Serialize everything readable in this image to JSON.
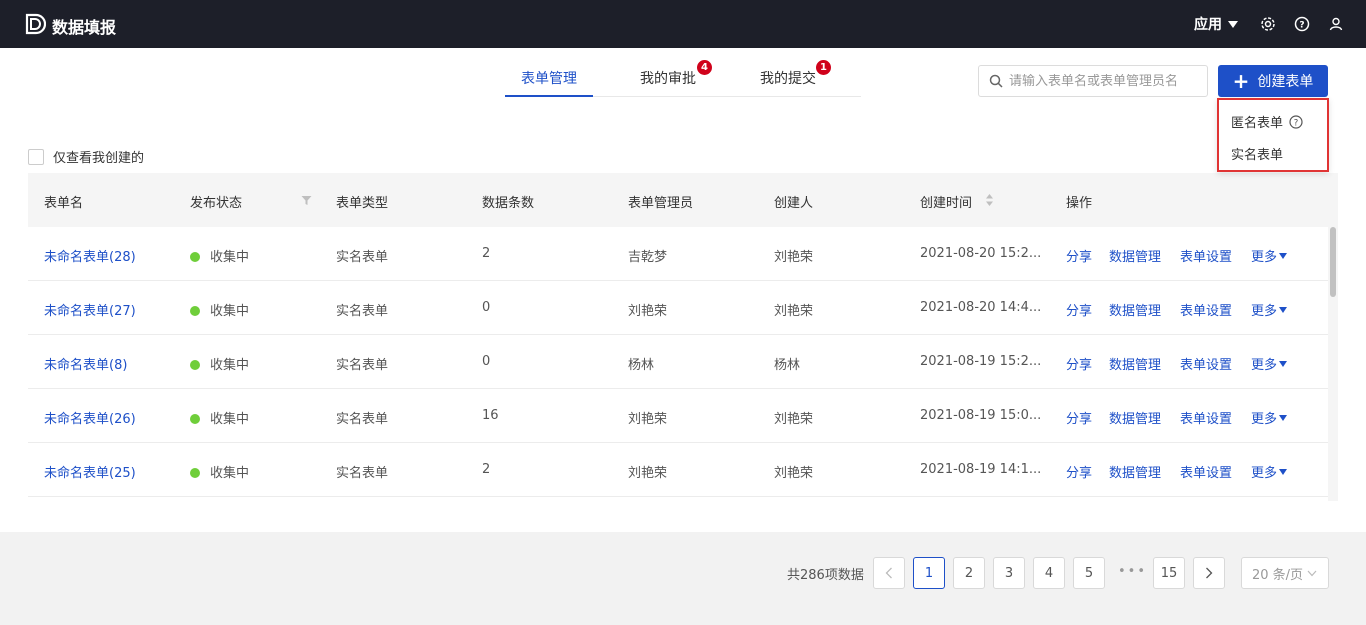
{
  "app": {
    "title": "数据填报",
    "logo_icon": "logo-icon"
  },
  "topbar": {
    "apps_label": "应用",
    "icons": [
      "settings-icon",
      "help-icon",
      "user-icon"
    ]
  },
  "tabs": [
    {
      "label": "表单管理",
      "active": true
    },
    {
      "label": "我的审批",
      "badge": "4"
    },
    {
      "label": "我的提交",
      "badge": "1"
    }
  ],
  "search": {
    "placeholder": "请输入表单名或表单管理员名",
    "value": ""
  },
  "create_button": {
    "label": "创建表单"
  },
  "create_menu": {
    "items": [
      "匿名表单",
      "实名表单"
    ]
  },
  "filter": {
    "only_mine_label": "仅查看我创建的",
    "checked": false
  },
  "table": {
    "columns": [
      "表单名",
      "发布状态",
      "表单类型",
      "数据条数",
      "表单管理员",
      "创建人",
      "创建时间",
      "操作"
    ],
    "rows": [
      {
        "name": "未命名表单(28)",
        "status": "收集中",
        "type": "实名表单",
        "count": "2",
        "admin": "吉乾梦",
        "creator": "刘艳荣",
        "created": "2021-08-20 15:2..."
      },
      {
        "name": "未命名表单(27)",
        "status": "收集中",
        "type": "实名表单",
        "count": "0",
        "admin": "刘艳荣",
        "creator": "刘艳荣",
        "created": "2021-08-20 14:4..."
      },
      {
        "name": "未命名表单(8)",
        "status": "收集中",
        "type": "实名表单",
        "count": "0",
        "admin": "杨林",
        "creator": "杨林",
        "created": "2021-08-19 15:2..."
      },
      {
        "name": "未命名表单(26)",
        "status": "收集中",
        "type": "实名表单",
        "count": "16",
        "admin": "刘艳荣",
        "creator": "刘艳荣",
        "created": "2021-08-19 15:0..."
      },
      {
        "name": "未命名表单(25)",
        "status": "收集中",
        "type": "实名表单",
        "count": "2",
        "admin": "刘艳荣",
        "creator": "刘艳荣",
        "created": "2021-08-19 14:1..."
      }
    ],
    "actions": [
      "分享",
      "数据管理",
      "表单设置",
      "更多"
    ]
  },
  "pagination": {
    "total_text": "共286项数据",
    "pages": [
      "1",
      "2",
      "3",
      "4",
      "5"
    ],
    "ellipsis": "•••",
    "last_page": "15",
    "current": "1",
    "page_size": "20 条/页"
  },
  "colors": {
    "primary": "#1e50c8",
    "topbar": "#1d1f29",
    "status_green": "#6fce3a",
    "badge_red": "#d0021b",
    "highlight_border": "#e03434"
  }
}
